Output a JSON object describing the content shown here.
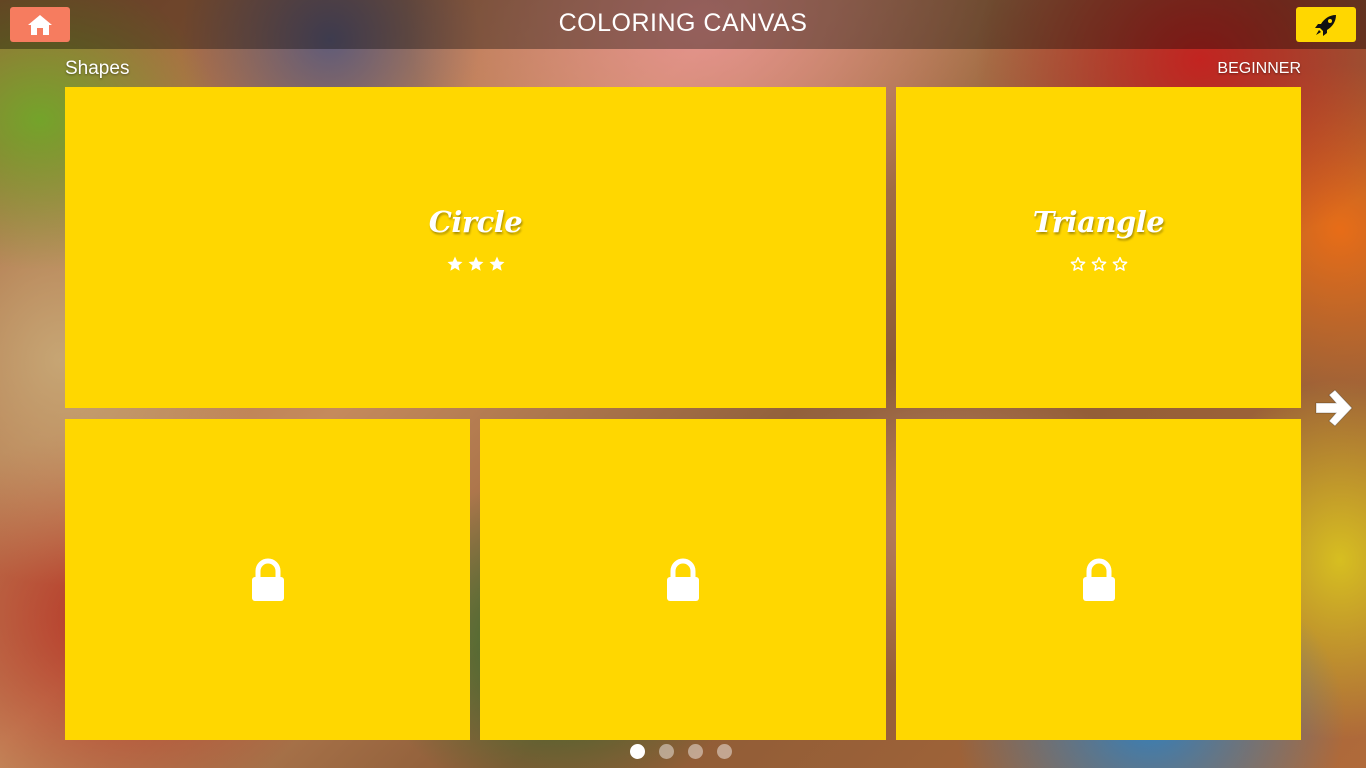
{
  "header": {
    "title": "COLORING CANVAS",
    "home_icon": "home-icon",
    "launch_icon": "rocket-icon"
  },
  "category": "Shapes",
  "level": "BEGINNER",
  "tiles": [
    {
      "name": "Circle",
      "locked": false,
      "stars_earned": 3,
      "stars_total": 3
    },
    {
      "name": "Triangle",
      "locked": false,
      "stars_earned": 0,
      "stars_total": 3
    },
    {
      "name": "",
      "locked": true,
      "icon": "lock-icon"
    },
    {
      "name": "",
      "locked": true,
      "icon": "lock-icon"
    },
    {
      "name": "",
      "locked": true,
      "icon": "lock-icon"
    }
  ],
  "navigation": {
    "next_icon": "arrow-right-icon"
  },
  "pagination": {
    "pages": 4,
    "current": 1
  },
  "colors": {
    "tile": "#ffd700",
    "home_button": "#f67c5f",
    "launch_button": "#ffd700",
    "text": "#ffffff",
    "icon_dark": "#111111"
  }
}
